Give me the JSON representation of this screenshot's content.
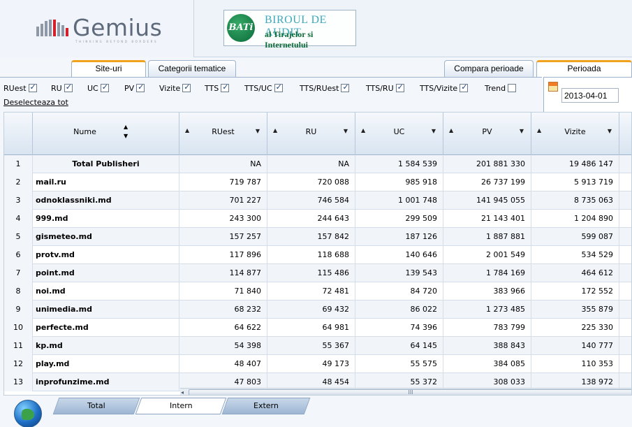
{
  "header": {
    "gemius_logo_text": "Gemius",
    "gemius_tagline": "THINKING BEYOND BORDERS",
    "bati_badge": "BATi",
    "bati_line1": "BIROUL DE AUDIT",
    "bati_line2": "al Tirajelor si Internetului"
  },
  "tabs": {
    "site_uri": "Site-uri",
    "categorii": "Categorii tematice",
    "compara": "Compara perioade",
    "perioada": "Perioada"
  },
  "options": {
    "items": [
      {
        "label": "RUest",
        "checked": true
      },
      {
        "label": "RU",
        "checked": true
      },
      {
        "label": "UC",
        "checked": true
      },
      {
        "label": "PV",
        "checked": true
      },
      {
        "label": "Vizite",
        "checked": true
      },
      {
        "label": "TTS",
        "checked": true
      },
      {
        "label": "TTS/UC",
        "checked": true
      },
      {
        "label": "TTS/RUest",
        "checked": true
      },
      {
        "label": "TTS/RU",
        "checked": true
      },
      {
        "label": "TTS/Vizite",
        "checked": true
      },
      {
        "label": "Trend",
        "checked": false
      }
    ],
    "deselect": "Deselecteaza tot"
  },
  "period": {
    "date": "2013-04-01"
  },
  "grid": {
    "columns": [
      "Nume",
      "RUest",
      "RU",
      "UC",
      "PV",
      "Vizite"
    ],
    "rows": [
      {
        "idx": "1",
        "name": "Total Publisheri",
        "ruest": "NA",
        "ru": "NA",
        "uc": "1 584 539",
        "pv": "201 881 330",
        "vizite": "19 486 147"
      },
      {
        "idx": "2",
        "name": "mail.ru",
        "ruest": "719 787",
        "ru": "720 088",
        "uc": "985 918",
        "pv": "26 737 199",
        "vizite": "5 913 719"
      },
      {
        "idx": "3",
        "name": "odnoklassniki.md",
        "ruest": "701 227",
        "ru": "746 584",
        "uc": "1 001 748",
        "pv": "141 945 055",
        "vizite": "8 735 063"
      },
      {
        "idx": "4",
        "name": "999.md",
        "ruest": "243 300",
        "ru": "244 643",
        "uc": "299 509",
        "pv": "21 143 401",
        "vizite": "1 204 890"
      },
      {
        "idx": "5",
        "name": "gismeteo.md",
        "ruest": "157 257",
        "ru": "157 842",
        "uc": "187 126",
        "pv": "1 887 881",
        "vizite": "599 087"
      },
      {
        "idx": "6",
        "name": "protv.md",
        "ruest": "117 896",
        "ru": "118 688",
        "uc": "140 646",
        "pv": "2 001 549",
        "vizite": "534 529"
      },
      {
        "idx": "7",
        "name": "point.md",
        "ruest": "114 877",
        "ru": "115 486",
        "uc": "139 543",
        "pv": "1 784 169",
        "vizite": "464 612"
      },
      {
        "idx": "8",
        "name": "noi.md",
        "ruest": "71 840",
        "ru": "72 481",
        "uc": "84 720",
        "pv": "383 966",
        "vizite": "172 552"
      },
      {
        "idx": "9",
        "name": "unimedia.md",
        "ruest": "68 232",
        "ru": "69 432",
        "uc": "86 022",
        "pv": "1 273 485",
        "vizite": "355 879"
      },
      {
        "idx": "10",
        "name": "perfecte.md",
        "ruest": "64 622",
        "ru": "64 981",
        "uc": "74 396",
        "pv": "783 799",
        "vizite": "225 330"
      },
      {
        "idx": "11",
        "name": "kp.md",
        "ruest": "54 398",
        "ru": "55 367",
        "uc": "64 145",
        "pv": "388 843",
        "vizite": "140 777"
      },
      {
        "idx": "12",
        "name": "play.md",
        "ruest": "48 407",
        "ru": "49 173",
        "uc": "55 575",
        "pv": "384 085",
        "vizite": "110 353"
      },
      {
        "idx": "13",
        "name": "inprofunzime.md",
        "ruest": "47 803",
        "ru": "48 454",
        "uc": "55 372",
        "pv": "308 033",
        "vizite": "138 972"
      }
    ],
    "scroll_grip": "III"
  },
  "bottom_tabs": {
    "total": "Total",
    "intern": "Intern",
    "extern": "Extern"
  },
  "colors": {
    "accent_tab": "#f0a21d",
    "gemius_red": "#d42029",
    "bati_green": "#0c6b36"
  }
}
